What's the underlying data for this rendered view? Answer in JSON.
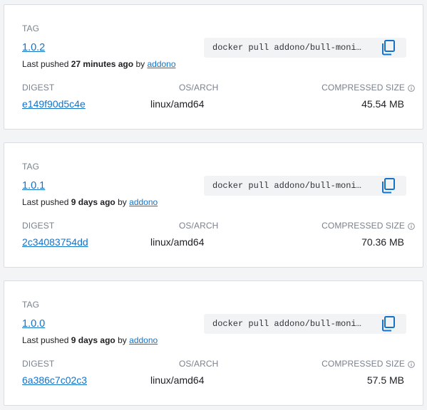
{
  "labels": {
    "tag": "TAG",
    "digest": "DIGEST",
    "os_arch": "OS/ARCH",
    "compressed_size": "COMPRESSED SIZE",
    "last_pushed_prefix": "Last pushed",
    "by": "by"
  },
  "colors": {
    "link": "#1473c9",
    "muted": "#7a828c"
  },
  "icons": {
    "copy": "copy-icon",
    "info": "info-icon"
  },
  "tags": [
    {
      "name": "1.0.2",
      "pushed_ago": "27 minutes ago",
      "user": "addono",
      "command": "docker pull addono/bull-moni…",
      "digest": "e149f90d5c4e",
      "os_arch": "linux/amd64",
      "size": "45.54 MB"
    },
    {
      "name": "1.0.1",
      "pushed_ago": "9 days ago",
      "user": "addono",
      "command": "docker pull addono/bull-moni…",
      "digest": "2c34083754dd",
      "os_arch": "linux/amd64",
      "size": "70.36 MB"
    },
    {
      "name": "1.0.0",
      "pushed_ago": "9 days ago",
      "user": "addono",
      "command": "docker pull addono/bull-moni…",
      "digest": "6a386c7c02c3",
      "os_arch": "linux/amd64",
      "size": "57.5 MB"
    }
  ]
}
